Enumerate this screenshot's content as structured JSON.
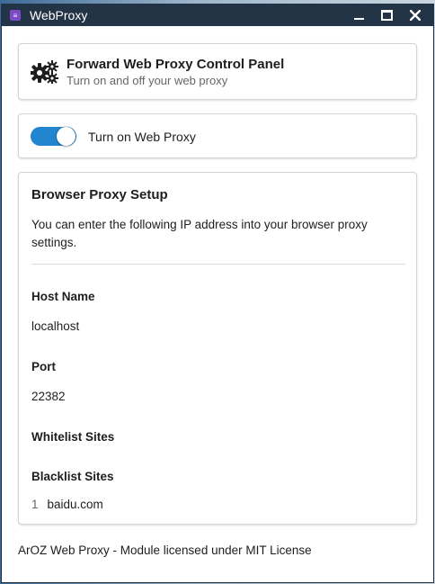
{
  "window": {
    "title": "WebProxy",
    "icon": "webproxy-app-icon",
    "controls": [
      "minimize-icon",
      "maximize-icon",
      "close-icon"
    ]
  },
  "header": {
    "icon": "gears-icon",
    "title": "Forward Web Proxy Control Panel",
    "subtitle": "Turn on and off your web proxy"
  },
  "toggle": {
    "label": "Turn on Web Proxy",
    "on": true,
    "color": "#2185d0"
  },
  "setup": {
    "title": "Browser Proxy Setup",
    "description": "You can enter the following IP address into your browser proxy settings.",
    "host_label": "Host Name",
    "host_value": "localhost",
    "port_label": "Port",
    "port_value": "22382",
    "whitelist_label": "Whitelist Sites",
    "blacklist_label": "Blacklist Sites",
    "blacklist": [
      {
        "num": "1",
        "site": "baidu.com"
      }
    ]
  },
  "footer": {
    "text": "ArOZ Web Proxy - Module licensed under MIT License"
  }
}
